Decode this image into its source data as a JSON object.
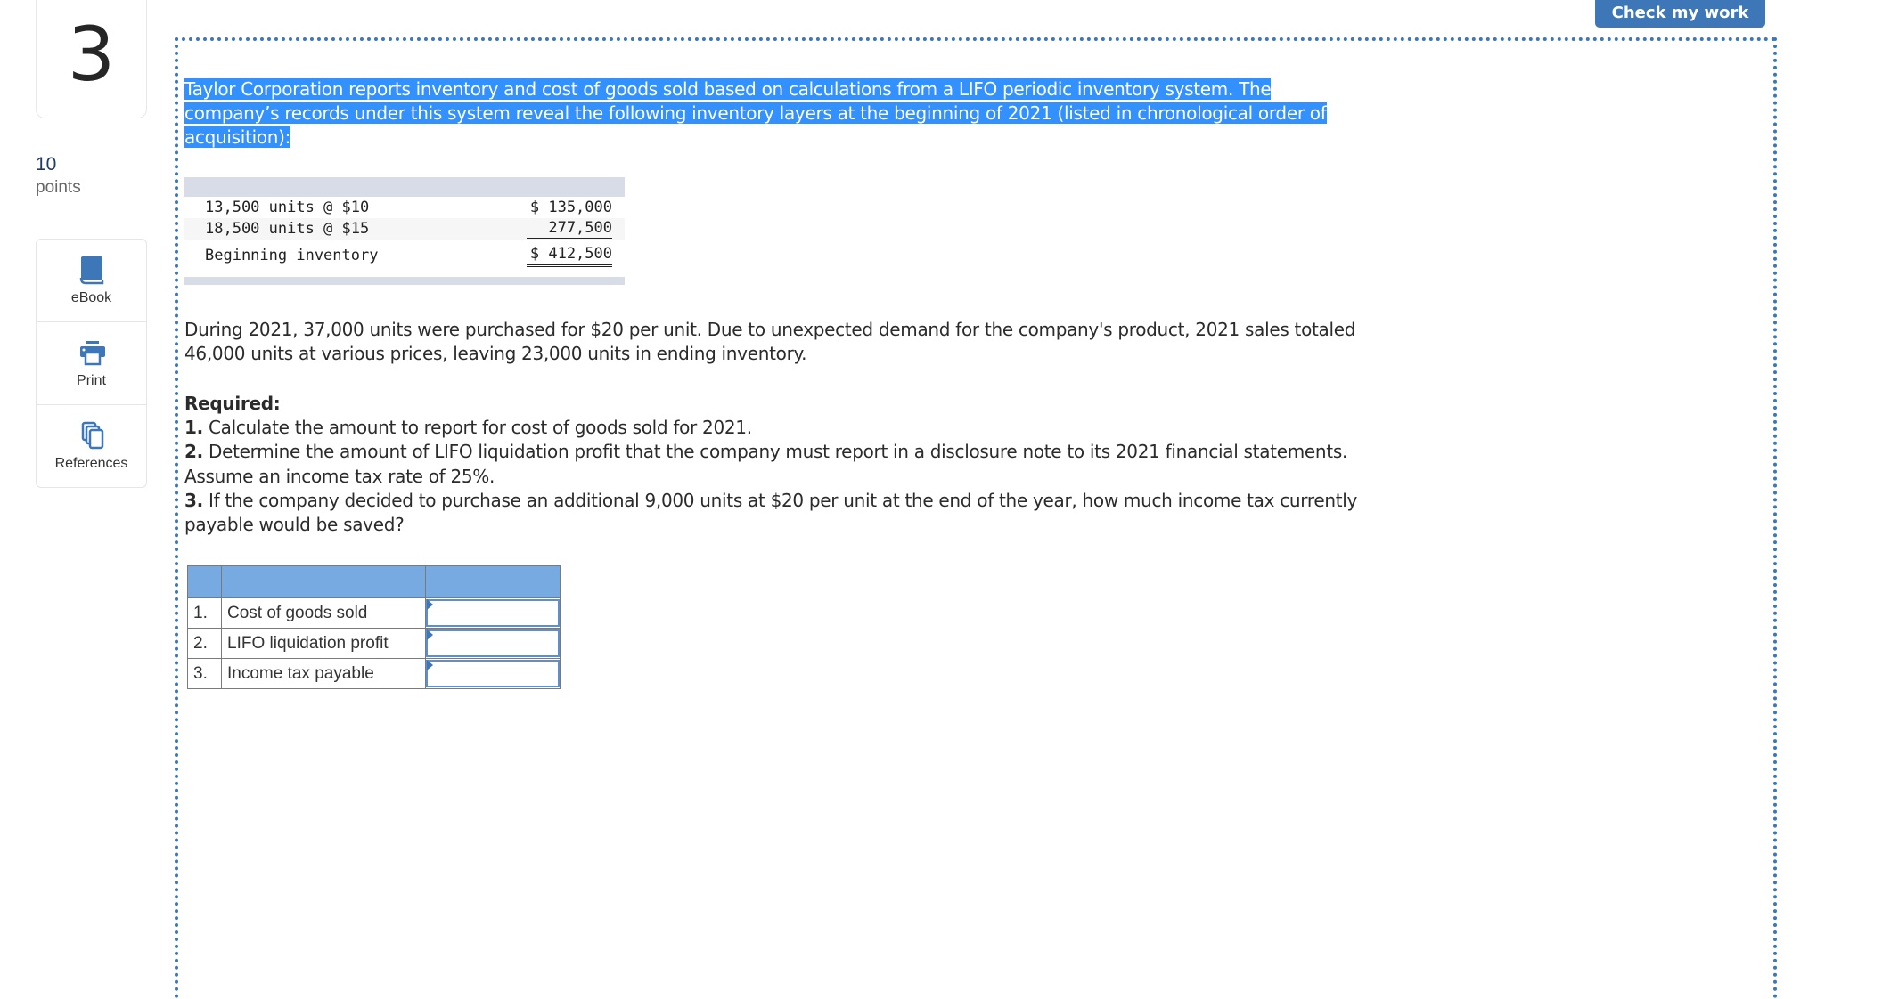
{
  "question": {
    "number": "3",
    "points_value": "10",
    "points_label": "points"
  },
  "tools": [
    {
      "label": "eBook",
      "icon": "book-icon"
    },
    {
      "label": "Print",
      "icon": "printer-icon"
    },
    {
      "label": "References",
      "icon": "copy-pages-icon"
    }
  ],
  "header": {
    "check_button_label": "Check my work"
  },
  "intro": {
    "line1": "Taylor Corporation reports inventory and cost of goods sold based on calculations from a LIFO periodic inventory system. The",
    "line2": "company’s records under this system reveal the following inventory layers at the beginning of 2021 (listed in chronological order of",
    "line3": "acquisition):"
  },
  "inventory_table": {
    "rows": [
      {
        "label": "13,500 units @ $10",
        "amount": "$ 135,000"
      },
      {
        "label": "18,500 units @ $15",
        "amount": "277,500"
      },
      {
        "label": "Beginning inventory",
        "amount": "$ 412,500"
      }
    ]
  },
  "paragraph2": {
    "line1": "During 2021, 37,000 units were purchased for $20 per unit. Due to unexpected demand for the company's product, 2021 sales totaled",
    "line2": "46,000 units at various prices, leaving 23,000 units in ending inventory."
  },
  "required": {
    "heading": "Required:",
    "items": [
      {
        "num": "1.",
        "text": " Calculate the amount to report for cost of goods sold for 2021."
      },
      {
        "num": "2.",
        "text": " Determine the amount of LIFO liquidation profit that the company must report in a disclosure note to its 2021 financial statements.",
        "text2": "Assume an income tax rate of 25%."
      },
      {
        "num": "3.",
        "text": " If the company decided to purchase an additional 9,000 units at $20 per unit at the end of the year, how much income tax currently",
        "text2": "payable would be saved?"
      }
    ]
  },
  "answer_table": {
    "rows": [
      {
        "num": "1.",
        "label": "Cost of goods sold",
        "value": ""
      },
      {
        "num": "2.",
        "label": "LIFO liquidation profit",
        "value": ""
      },
      {
        "num": "3.",
        "label": "Income tax payable",
        "value": ""
      }
    ]
  },
  "colors": {
    "accent": "#3d77b8",
    "selection_highlight": "#3390ff",
    "answer_header": "#78aae2"
  }
}
